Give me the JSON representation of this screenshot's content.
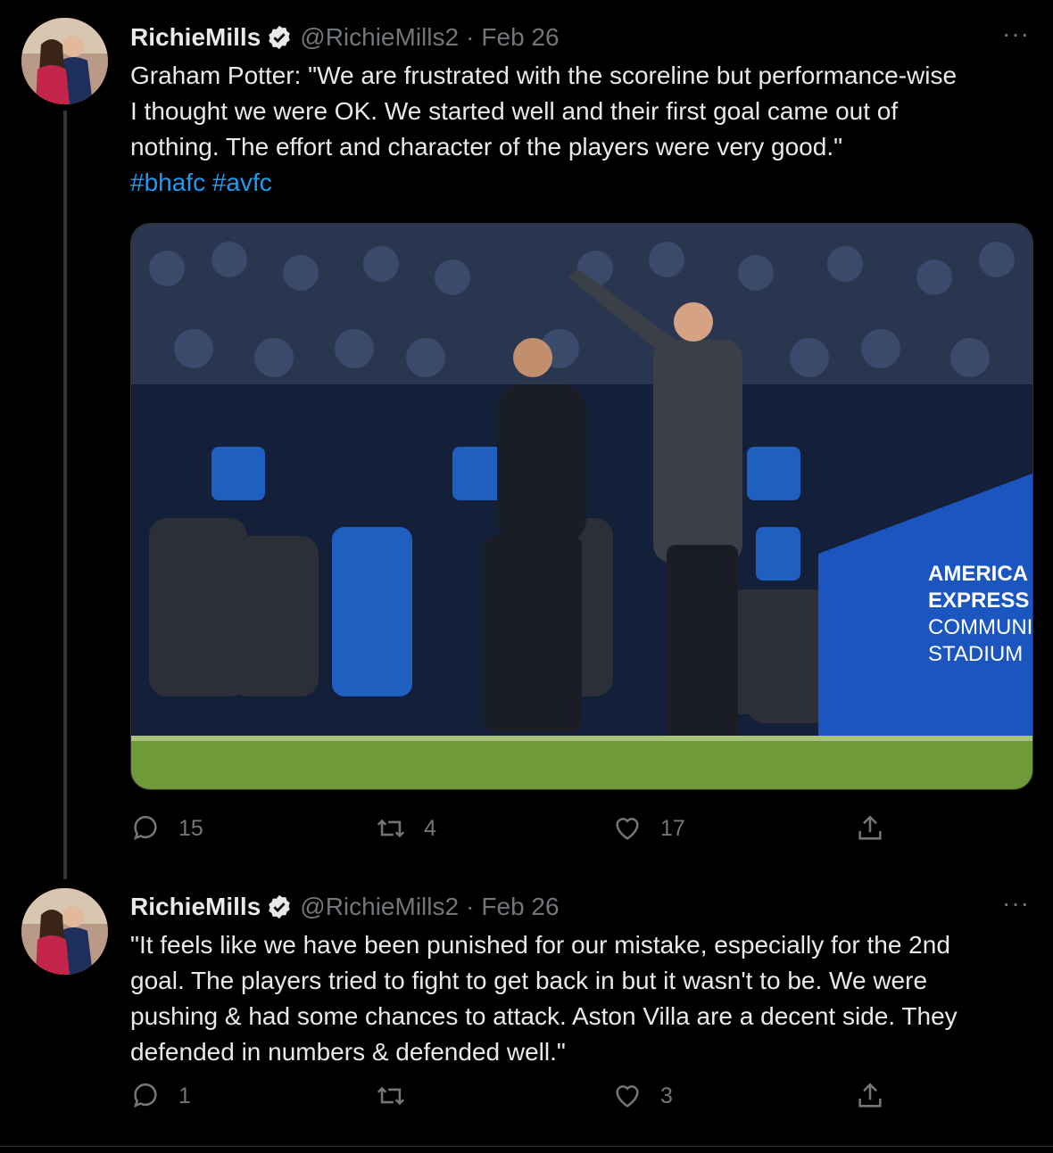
{
  "tweets": [
    {
      "display_name": "RichieMills",
      "handle": "@RichieMills2",
      "separator": "·",
      "date": "Feb 26",
      "more": "···",
      "text_lines": [
        "Graham Potter: \"We are frustrated with the scoreline but performance-wise",
        "I thought we were OK. We started well and their first goal came out of",
        "nothing. The effort and character of the players were very good.\""
      ],
      "hashtags": [
        "#bhafc",
        "#avfc"
      ],
      "photo_sign": [
        "AMERICA",
        "EXPRESS",
        "COMMUNIT",
        "STADIUM"
      ],
      "replies": "15",
      "retweets": "4",
      "likes": "17"
    },
    {
      "display_name": "RichieMills",
      "handle": "@RichieMills2",
      "separator": "·",
      "date": "Feb 26",
      "more": "···",
      "text_lines": [
        "\"It feels like we have been punished for our mistake, especially for the 2nd",
        "goal. The players tried to fight to get back in but it wasn't to be. We were",
        "pushing & had some chances to attack. Aston Villa are a decent side. They",
        "defended in numbers & defended well.\""
      ],
      "replies": "1",
      "retweets": "",
      "likes": "3"
    }
  ],
  "icons": [
    "reply-icon",
    "retweet-icon",
    "like-icon",
    "share-icon",
    "verified-badge-icon",
    "more-options-icon"
  ],
  "colors": {
    "background": "#000000",
    "text": "#e7e9ea",
    "muted": "#71767b",
    "link": "#1d9bf0",
    "verified": "#e7e9ea"
  }
}
